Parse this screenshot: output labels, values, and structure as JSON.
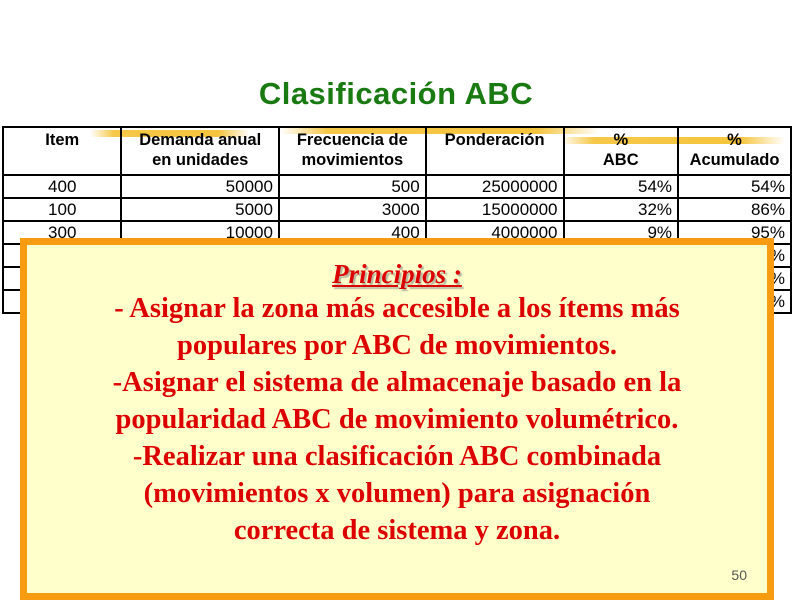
{
  "slide": {
    "title": "Clasificación ABC",
    "page_number": "50"
  },
  "table": {
    "headers": [
      [
        "Item",
        ""
      ],
      [
        "Demanda anual",
        "en unidades"
      ],
      [
        "Frecuencia de",
        "movimientos"
      ],
      [
        "Ponderación",
        ""
      ],
      [
        "%",
        "ABC"
      ],
      [
        "%",
        "Acumulado"
      ]
    ],
    "rows": [
      [
        "400",
        "50000",
        "500",
        "25000000",
        "54%",
        "54%"
      ],
      [
        "100",
        "5000",
        "3000",
        "15000000",
        "32%",
        "86%"
      ],
      [
        "300",
        "10000",
        "400",
        "4000000",
        "9%",
        "95%"
      ],
      [
        "",
        "",
        "",
        "",
        "",
        "%"
      ],
      [
        "",
        "",
        "",
        "",
        "",
        "%"
      ],
      [
        "",
        "",
        "",
        "",
        "",
        "%"
      ]
    ]
  },
  "callout": {
    "heading": "Principios :",
    "lines": [
      "- Asignar la zona más accesible a los ítems más",
      "populares por ABC de movimientos.",
      "-Asignar el sistema de almacenaje basado en la",
      "popularidad ABC de movimiento volumétrico.",
      "-Realizar una clasificación ABC combinada",
      "(movimientos x volumen) para asignación",
      "correcta de sistema  y zona."
    ]
  },
  "colors": {
    "title": "#1a7a12",
    "callout_text": "#dd0000",
    "callout_bg": "#ffffcc",
    "callout_border": "#f79b11",
    "brush": "#f4be28"
  }
}
